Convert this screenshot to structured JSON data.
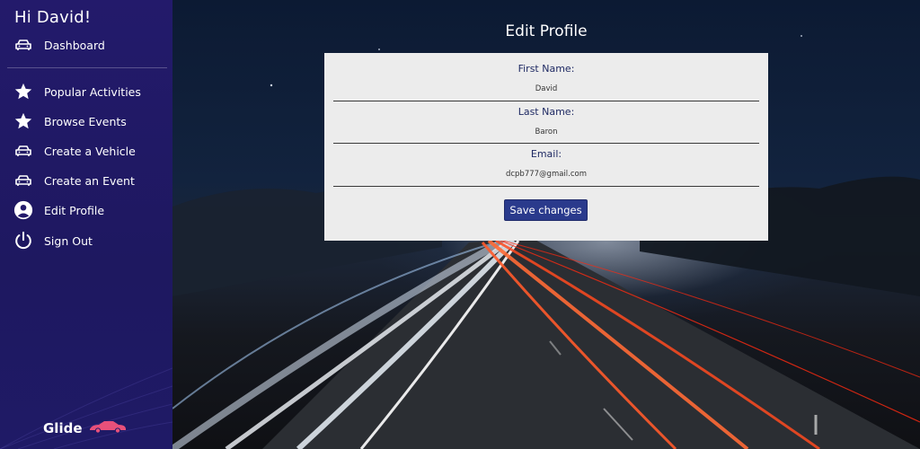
{
  "sidebar": {
    "greeting": "Hi David!",
    "items": [
      {
        "label": "Dashboard",
        "icon": "car-icon"
      },
      {
        "label": "Popular Activities",
        "icon": "star-icon"
      },
      {
        "label": "Browse Events",
        "icon": "star-icon"
      },
      {
        "label": "Create a Vehicle",
        "icon": "car-icon"
      },
      {
        "label": "Create an Event",
        "icon": "car-icon"
      },
      {
        "label": "Edit Profile",
        "icon": "user-circle-icon"
      },
      {
        "label": "Sign Out",
        "icon": "power-icon"
      }
    ],
    "brand": "Glide",
    "brand_accent": "#e8507a",
    "background": "#231a6b"
  },
  "main": {
    "title": "Edit Profile",
    "form": {
      "first_name_label": "First Name:",
      "first_name_value": "David",
      "last_name_label": "Last Name:",
      "last_name_value": "Baron",
      "email_label": "Email:",
      "email_value": "dcpb777@gmail.com",
      "save_label": "Save changes"
    },
    "button_color": "#2a3a8c"
  }
}
